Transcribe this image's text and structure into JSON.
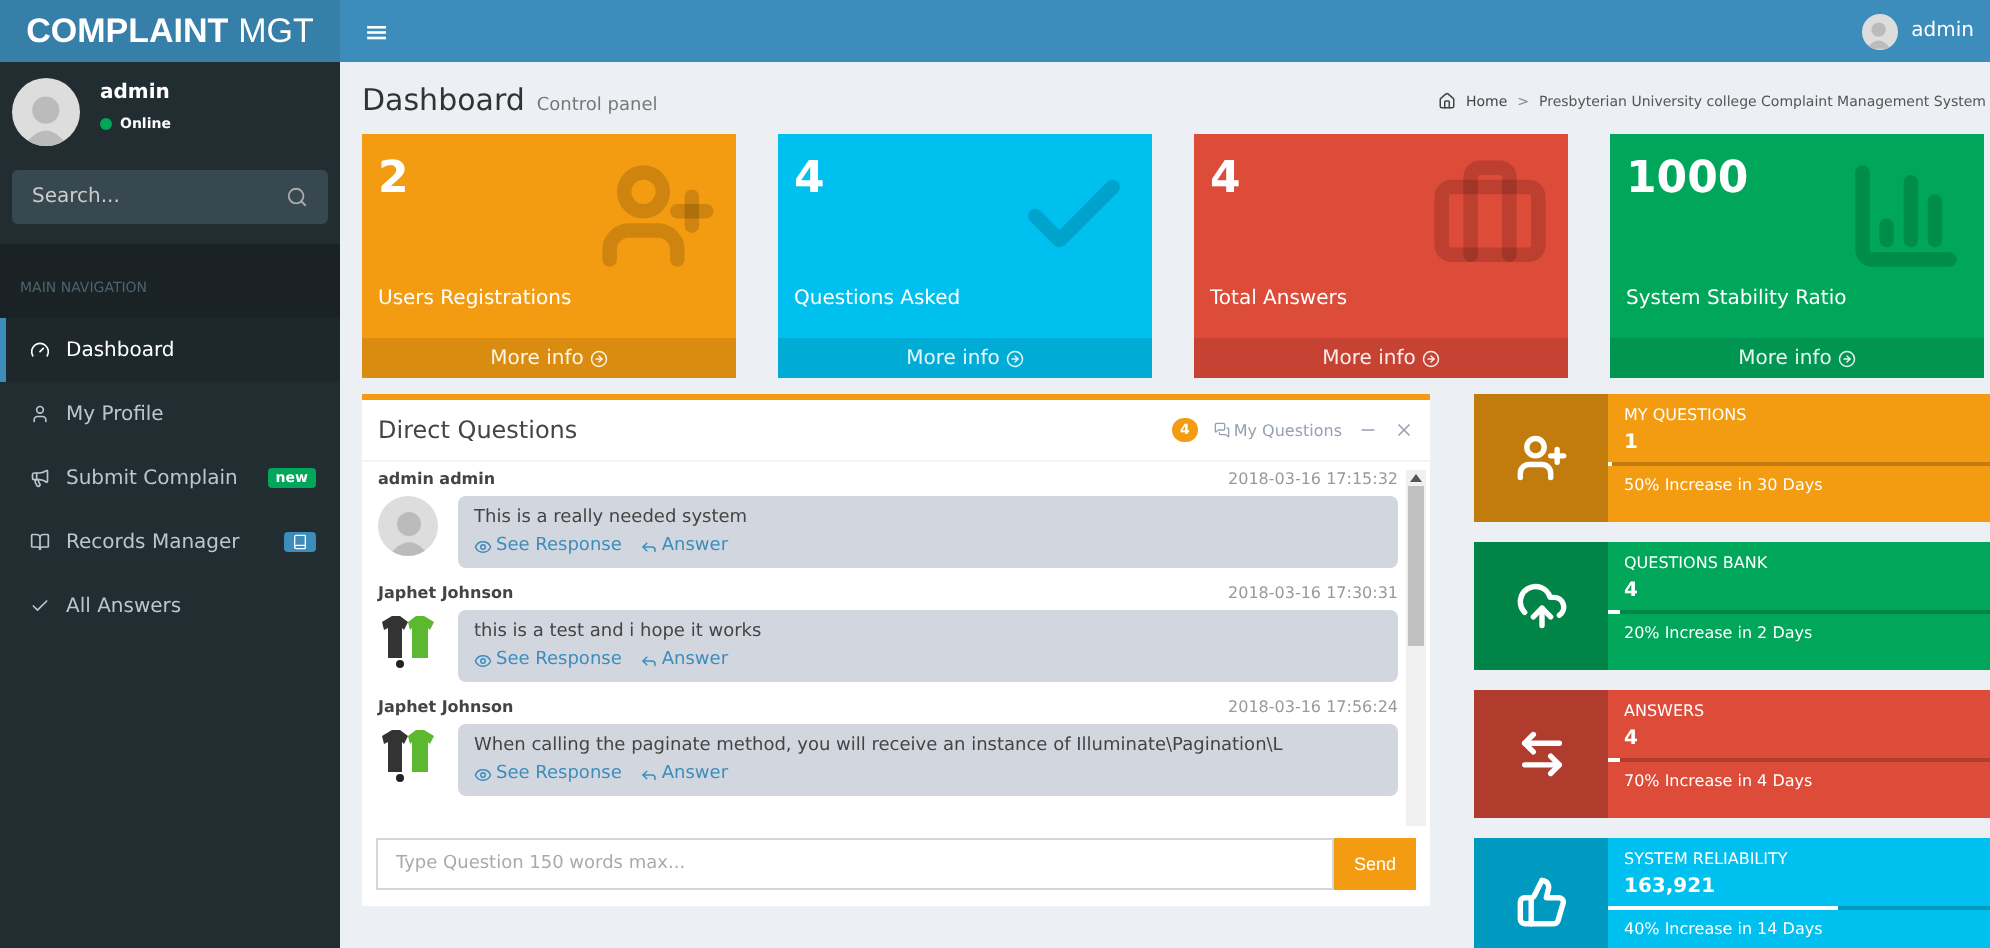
{
  "header": {
    "logo_bold": "COMPLAINT",
    "logo_light": "MGT",
    "menu_glyph": "≡",
    "user": "admin"
  },
  "sidebar": {
    "user": {
      "name": "admin",
      "status": "Online",
      "online": true
    },
    "search": {
      "placeholder": "Search..."
    },
    "section": "MAIN NAVIGATION",
    "items": [
      {
        "label": "Dashboard",
        "selected": true
      },
      {
        "label": "My Profile",
        "selected": false
      },
      {
        "label": "Submit Complain",
        "selected": false,
        "badge": {
          "kind": "text",
          "text": "new",
          "color": "#00a65a"
        }
      },
      {
        "label": "Records Manager",
        "selected": false,
        "badge": {
          "kind": "icon",
          "color": "#3c8dbc"
        }
      },
      {
        "label": "All Answers",
        "selected": false
      }
    ]
  },
  "page": {
    "title": "Dashboard",
    "subtitle": "Control panel",
    "breadcrumb": [
      "Home",
      "Presbyterian University college Complaint Management System"
    ],
    "separator": ">"
  },
  "stats": [
    {
      "value": "2",
      "label": "Users Registrations",
      "color": "#f39c12",
      "footer": "More info"
    },
    {
      "value": "4",
      "label": "Questions Asked",
      "color": "#00c0ef",
      "footer": "More info"
    },
    {
      "value": "4",
      "label": "Total Answers",
      "color": "#dd4b39",
      "footer": "More info"
    },
    {
      "value": "1000",
      "label": "System Stability Ratio",
      "color": "#00a65a",
      "footer": "More info"
    }
  ],
  "chat": {
    "title": "Direct Questions",
    "count": "4",
    "link": "My Questions",
    "messages": [
      {
        "author": "admin admin",
        "time": "2018-03-16 17:15:32",
        "text": "This is a really needed system",
        "kind": "default",
        "actions": [
          "See Response",
          "Answer"
        ]
      },
      {
        "author": "Japhet Johnson",
        "time": "2018-03-16 17:30:31",
        "text": "this is a test and i hope it works",
        "kind": "custom",
        "actions": [
          "See Response",
          "Answer"
        ]
      },
      {
        "author": "Japhet Johnson",
        "time": "2018-03-16 17:56:24",
        "text": "When calling the paginate method, you will receive an instance of Illuminate\\Pagination\\L",
        "kind": "custom",
        "actions": [
          "See Response",
          "Answer"
        ]
      }
    ],
    "input": {
      "placeholder": "Type Question 150 words max..."
    },
    "send": "Send"
  },
  "info_boxes": [
    {
      "title": "MY QUESTIONS",
      "value": "1",
      "level": 0.01,
      "note": "50% Increase in 30 Days",
      "color": "#f39c12"
    },
    {
      "title": "QUESTIONS BANK",
      "value": "4",
      "level": 0.03,
      "note": "20% Increase in 2 Days",
      "color": "#00a65a"
    },
    {
      "title": "ANSWERS",
      "value": "4",
      "level": 0.03,
      "note": "70% Increase in 4 Days",
      "color": "#dd4b39"
    },
    {
      "title": "SYSTEM RELIABILITY",
      "value": "163,921",
      "level": 0.6,
      "note": "40% Increase in 14 Days",
      "color": "#00c0ef"
    }
  ]
}
